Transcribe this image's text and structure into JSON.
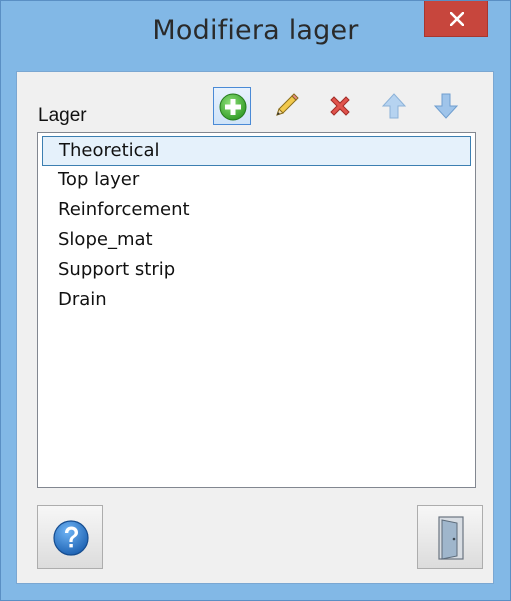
{
  "window": {
    "title": "Modifiera lager",
    "close_icon": "close-icon"
  },
  "toolbar": {
    "label": "Lager",
    "buttons": [
      {
        "name": "add",
        "icon": "add-icon",
        "active": true
      },
      {
        "name": "edit",
        "icon": "pencil-icon",
        "active": false
      },
      {
        "name": "delete",
        "icon": "delete-icon",
        "active": false
      },
      {
        "name": "move-up",
        "icon": "arrow-up-icon",
        "active": false
      },
      {
        "name": "move-down",
        "icon": "arrow-down-icon",
        "active": false
      }
    ]
  },
  "layers": {
    "items": [
      {
        "label": "Theoretical",
        "selected": true
      },
      {
        "label": "Top layer",
        "selected": false
      },
      {
        "label": "Reinforcement",
        "selected": false
      },
      {
        "label": "Slope_mat",
        "selected": false
      },
      {
        "label": "Support strip",
        "selected": false
      },
      {
        "label": "Drain",
        "selected": false
      }
    ]
  },
  "footer": {
    "help_icon": "help-icon",
    "exit_icon": "exit-door-icon"
  },
  "colors": {
    "frame": "#82b8e6",
    "close": "#c7463d",
    "selection_border": "#3c7fb1",
    "selection_fill": "#e5f1fb"
  }
}
